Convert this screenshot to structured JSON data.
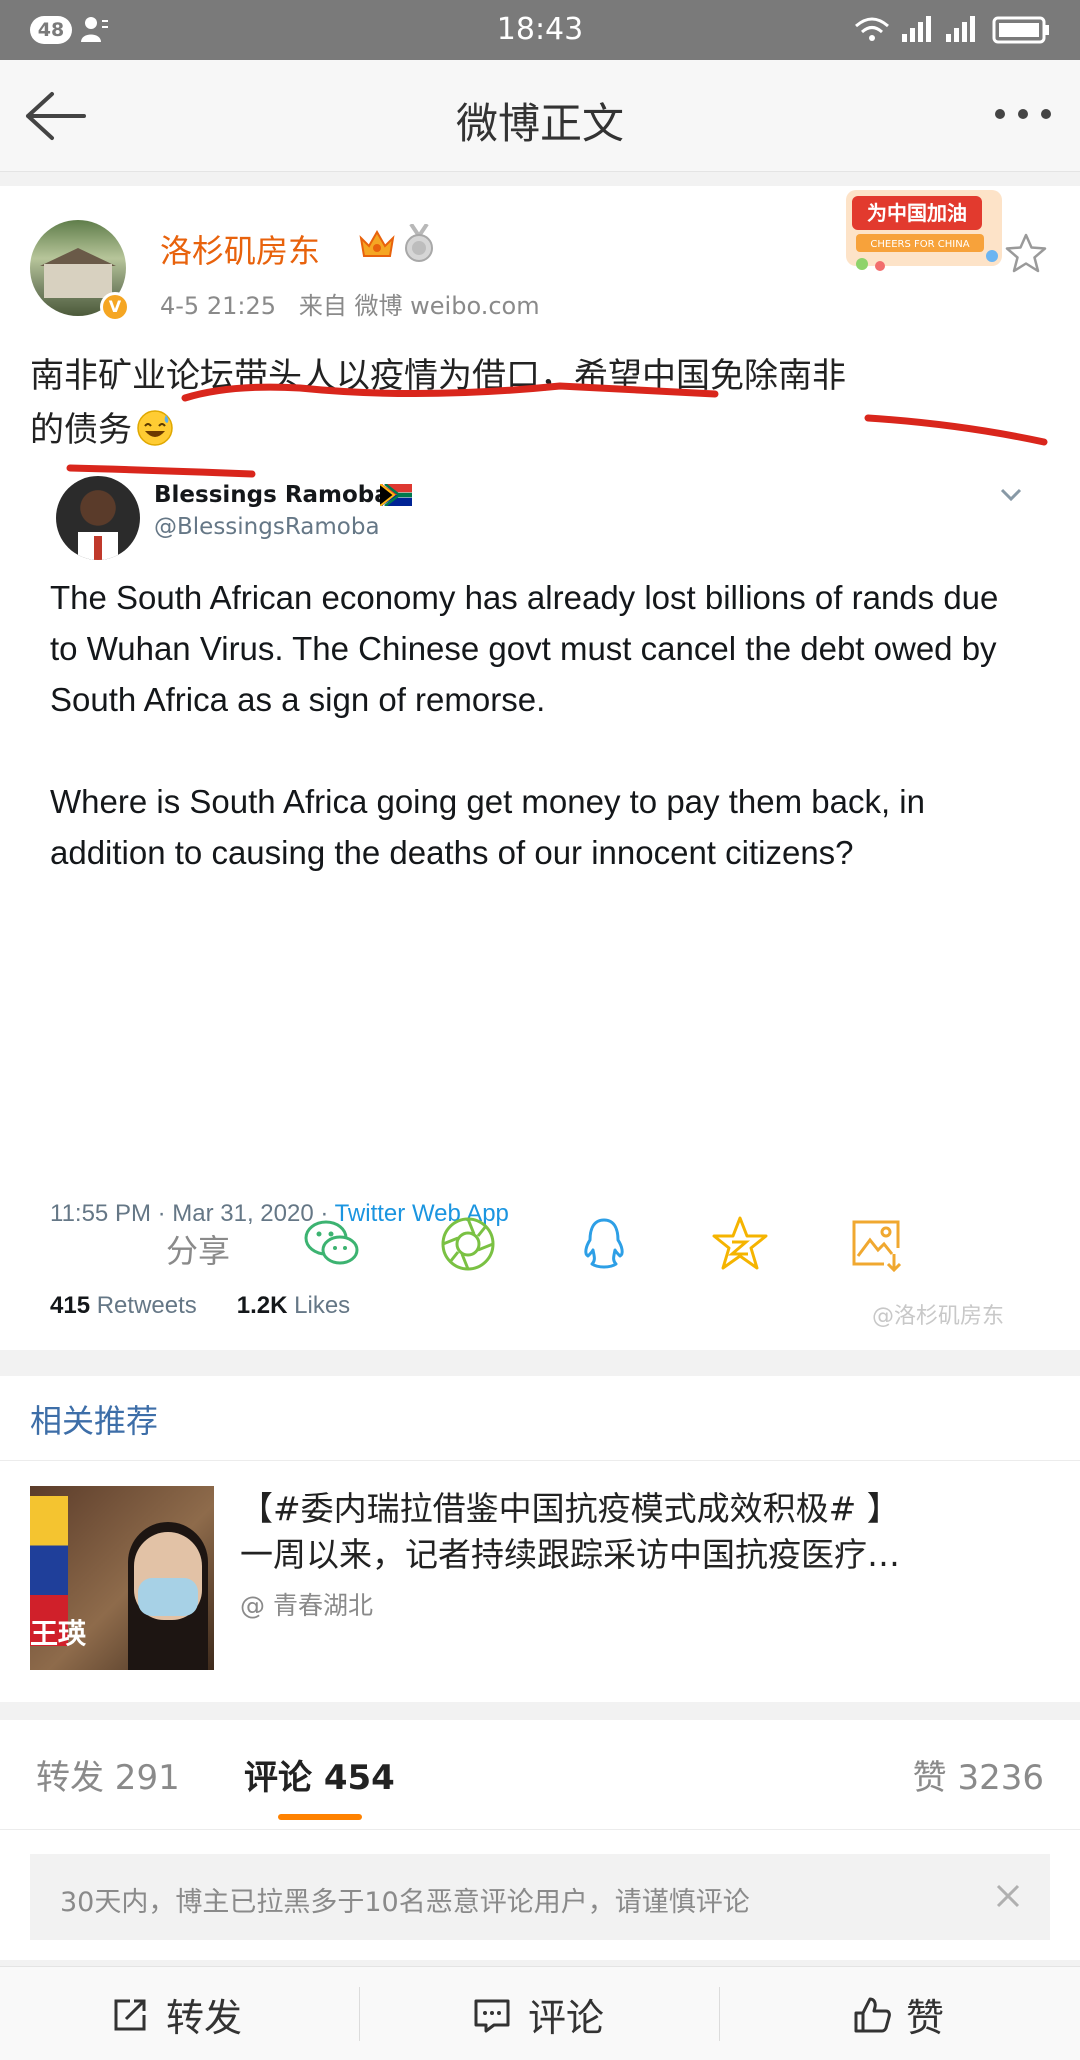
{
  "status_bar": {
    "notification_count": "48",
    "time": "18:43"
  },
  "nav": {
    "title": "微博正文"
  },
  "post": {
    "username": "洛杉矶房东",
    "verified_badge": "V",
    "timestamp": "4-5 21:25",
    "source": "来自 微博 weibo.com",
    "text_line1": "南非矿业论坛带头人以疫情为借口，希望中国免除南非",
    "text_line2": "的债务",
    "campaign_badge": "为中国加油",
    "campaign_sub": "CHEERS FOR CHINA",
    "tweet": {
      "name": "Blessings Ramoba",
      "handle": "@BlessingsRamoba",
      "paragraph1": "The South African economy has already lost billions of rands due to Wuhan Virus. The Chinese govt must cancel the debt owed by South Africa as a sign of remorse.",
      "paragraph2": "Where is South Africa going get money to pay them back, in addition to causing the deaths of our innocent citizens?",
      "datetime": "11:55 PM · Mar 31, 2020 · ",
      "app": "Twitter Web App",
      "retweets_count": "415",
      "retweets_label": " Retweets",
      "likes_count": "1.2K",
      "likes_label": " Likes"
    },
    "watermark": "@洛杉矶房东",
    "share_label": "分享",
    "share_icons": [
      "wechat-icon",
      "moments-icon",
      "qq-icon",
      "qzone-icon",
      "save-image-icon"
    ]
  },
  "related": {
    "heading": "相关推荐",
    "item": {
      "thumb_caption": "王瑛",
      "title_line1": "【#委内瑞拉借鉴中国抗疫模式成效积极# 】",
      "title_line2": "一周以来，记者持续跟踪采访中国抗疫医疗…",
      "source": "@ 青春湖北"
    }
  },
  "tabs": {
    "repost": "转发 291",
    "comment": "评论 454",
    "like": "赞 3236"
  },
  "notice": {
    "text": "30天内，博主已拉黑多于10名恶意评论用户，请谨慎评论"
  },
  "bottom_bar": {
    "repost": "转发",
    "comment": "评论",
    "like": "赞"
  },
  "colors": {
    "accent": "#ff8200",
    "username": "#e8620c",
    "link": "#3d6ea8",
    "twitter_blue": "#1b95e0",
    "annotation_red": "#d9261c"
  }
}
